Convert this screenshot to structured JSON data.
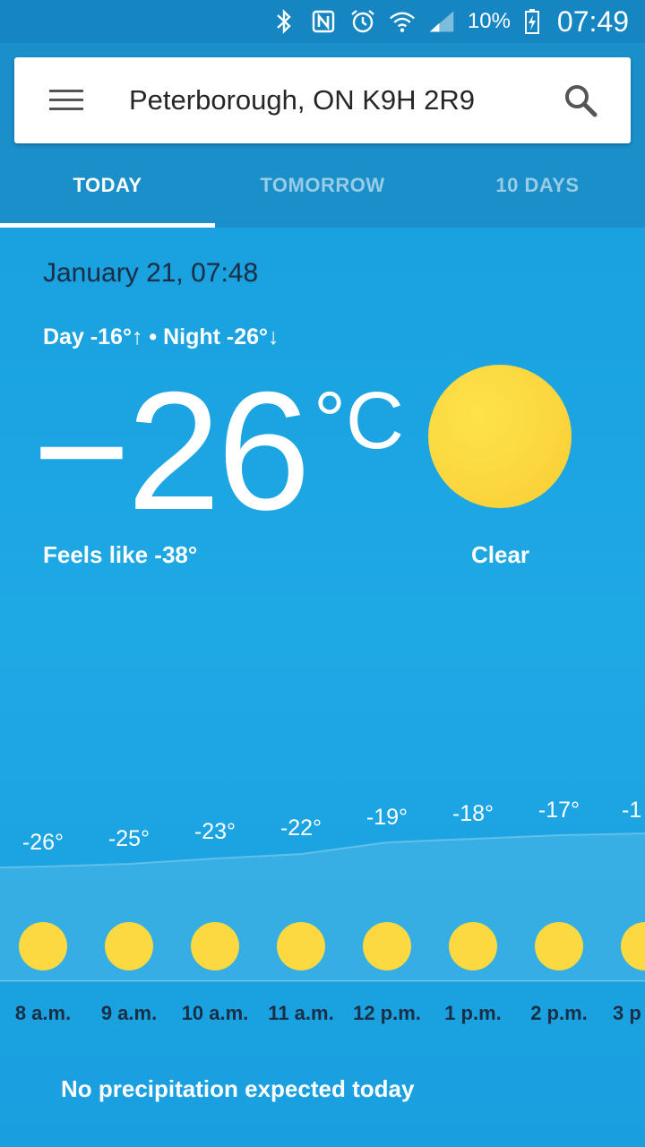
{
  "status_bar": {
    "battery_percent": "10%",
    "time": "07:49",
    "icons": [
      "bluetooth-icon",
      "nfc-icon",
      "alarm-icon",
      "wifi-icon",
      "signal-icon",
      "battery-charging-icon"
    ]
  },
  "search": {
    "location": "Peterborough, ON K9H 2R9"
  },
  "tabs": [
    {
      "label": "TODAY",
      "active": true
    },
    {
      "label": "TOMORROW",
      "active": false
    },
    {
      "label": "10 DAYS",
      "active": false
    }
  ],
  "current": {
    "datetime": "January 21, 07:48",
    "day_night": "Day -16°↑ • Night -26°↓",
    "temperature": "−26",
    "unit": "°C",
    "feels_like": "Feels like -38°",
    "condition": "Clear"
  },
  "hourly": [
    {
      "time": "8 a.m.",
      "temp": "-26°"
    },
    {
      "time": "9 a.m.",
      "temp": "-25°"
    },
    {
      "time": "10 a.m.",
      "temp": "-23°"
    },
    {
      "time": "11 a.m.",
      "temp": "-22°"
    },
    {
      "time": "12 p.m.",
      "temp": "-19°"
    },
    {
      "time": "1 p.m.",
      "temp": "-18°"
    },
    {
      "time": "2 p.m.",
      "temp": "-17°"
    },
    {
      "time": "3 p",
      "temp": "-1"
    }
  ],
  "precipitation": "No precipitation expected today",
  "colors": {
    "sun": "#fcd940",
    "sky": "#1ea8e4",
    "header": "#1a8fca"
  }
}
